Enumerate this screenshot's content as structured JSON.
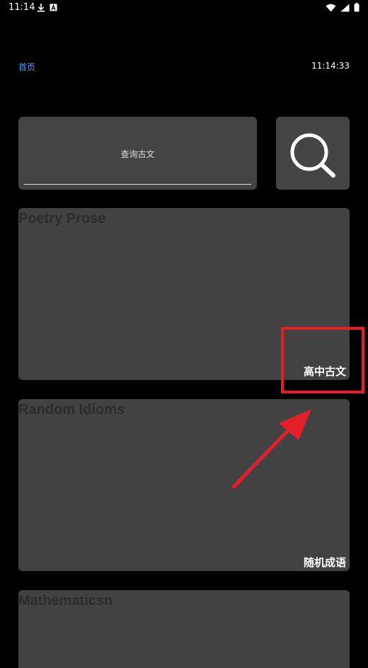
{
  "status_bar": {
    "time": "11:14"
  },
  "header": {
    "home_label": "首页",
    "clock": "11:14:33"
  },
  "search": {
    "placeholder": "查询古文"
  },
  "cards": [
    {
      "title": "Poetry  Prose",
      "subtitle": "高中古文"
    },
    {
      "title": "Random Idioms",
      "subtitle": "随机成语"
    },
    {
      "title": "Mathematicsn",
      "subtitle": ""
    }
  ],
  "colors": {
    "accent": "#4aa3ff",
    "card_bg": "#424242",
    "annotation": "#e3202a"
  }
}
